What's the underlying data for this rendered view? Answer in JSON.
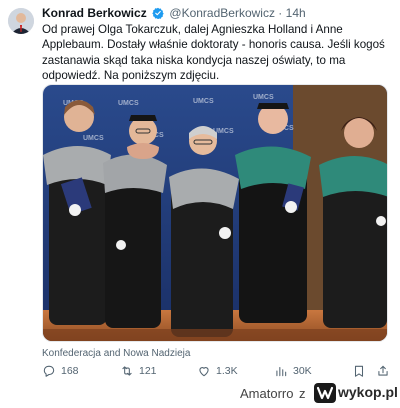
{
  "tweet": {
    "author_name": "Konrad Berkowicz",
    "handle": "@KonradBerkowicz",
    "separator": "·",
    "time": "14h",
    "text": "Od prawej Olga Tokarczuk, dalej Agnieszka Holland i Anne Applebaum. Dostały właśnie doktoraty - honoris causa. Jeśli kogoś zastanawia skąd taka niska kondycja naszej oświaty, to ma odpowiedź. Na poniższym zdjęciu.",
    "media_attribution": "Konfederacja and Nowa Nadzieja",
    "media_backdrop_label": "UMCS"
  },
  "actions": {
    "replies": "168",
    "retweets": "121",
    "likes": "1.3K",
    "views": "30K"
  },
  "footer": {
    "user": "Amatorro",
    "separator": "z",
    "site": "wykop.pl"
  },
  "colors": {
    "verified": "#1d9bf0",
    "meta_text": "#536471",
    "backdrop": "#1f3b7a",
    "gown": "#1c1c1c",
    "hood_grey": "#a9acae",
    "hood_teal": "#2f8a7a",
    "floor": "#c8703d"
  },
  "icons": [
    "verified-badge-icon",
    "reply-icon",
    "retweet-icon",
    "like-icon",
    "views-icon",
    "bookmark-icon",
    "share-icon",
    "wykop-logo-icon"
  ]
}
